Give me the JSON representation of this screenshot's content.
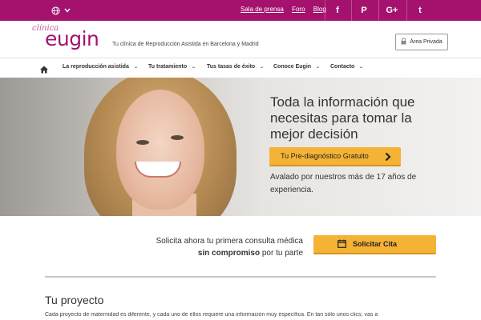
{
  "topbar": {
    "links": [
      "Sala de prensa",
      "Foro",
      "Blog"
    ],
    "social": [
      "f",
      "P",
      "G+",
      "t"
    ]
  },
  "header": {
    "logo_small": "clínica",
    "logo_big": "eugin",
    "tagline": "Tu clínica de Reproducción Asistida en Barcelona y Madrid",
    "area_label": "Área Privada"
  },
  "nav": {
    "items": [
      "La reproducción asistida",
      "Tu tratamiento",
      "Tus tasas de éxito",
      "Conoce Eugin",
      "Contacto"
    ]
  },
  "hero": {
    "title": "Toda la información que necesitas para tomar la mejor decisión",
    "button_label": "Tu Pre-diagnóstico Gratuito",
    "subtitle": "Avalado por nuestros más de 17 años de experiencia."
  },
  "cta": {
    "line1": "Solicita ahora tu primera consulta médica",
    "line2_bold": "sin compromiso",
    "line2_rest": " por tu parte",
    "button_label": "Solicitar Cita"
  },
  "section": {
    "title": "Tu proyecto",
    "text": "Cada proyecto de maternidad es diferente, y cada uno de ellos requiere una información muy específica. En tan sólo unos clics; vas a"
  },
  "colors": {
    "brand": "#a4126e",
    "accent": "#f5b335"
  }
}
